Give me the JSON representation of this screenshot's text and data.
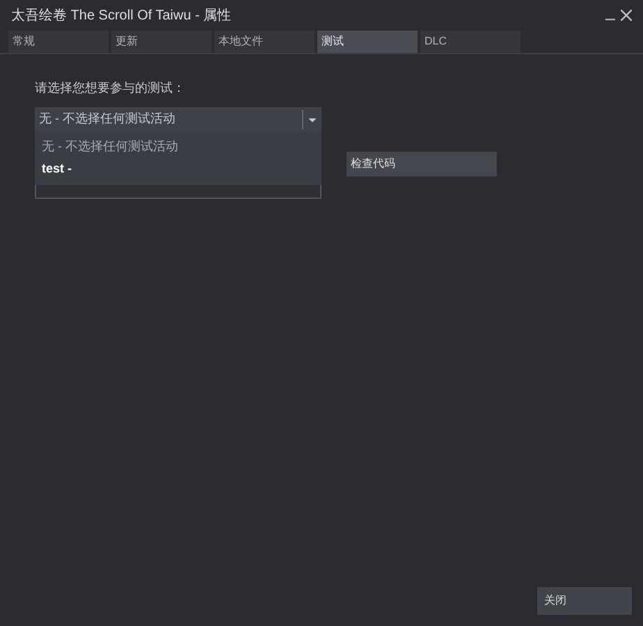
{
  "window": {
    "title": "太吾绘卷 The Scroll Of Taiwu - 属性"
  },
  "tabs": [
    {
      "label": "常规",
      "selected": false
    },
    {
      "label": "更新",
      "selected": false
    },
    {
      "label": "本地文件",
      "selected": false
    },
    {
      "label": "测试",
      "selected": true
    },
    {
      "label": "DLC",
      "selected": false
    }
  ],
  "beta": {
    "prompt": "请选择您想要参与的测试：",
    "dropdown": {
      "value": "无 - 不选择任何测试活动",
      "expanded": true,
      "options": [
        {
          "label": "无 - 不选择任何测试活动",
          "highlighted": false
        },
        {
          "label": "test -",
          "highlighted": true
        }
      ]
    },
    "check_button": "检查代码"
  },
  "buttons": [
    "关闭"
  ]
}
